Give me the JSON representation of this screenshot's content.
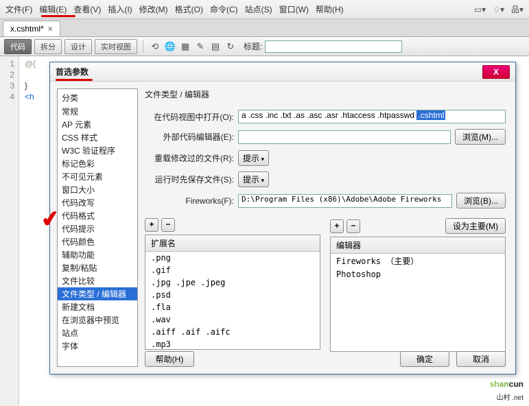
{
  "menu": {
    "items": [
      "文件(F)",
      "编辑(E)",
      "查看(V)",
      "插入(I)",
      "修改(M)",
      "格式(O)",
      "命令(C)",
      "站点(S)",
      "窗口(W)",
      "帮助(H)"
    ]
  },
  "tab": {
    "name": "x.cshtml*"
  },
  "toolbar": {
    "buttons": [
      "代码",
      "拆分",
      "设计",
      "实时视图"
    ],
    "title_label": "标题:"
  },
  "gutter": [
    "1",
    "2",
    "3",
    "4"
  ],
  "code": {
    "l1": "@{",
    "l2": "",
    "l3": "}",
    "l4": "<h"
  },
  "dialog": {
    "title": "首选参数",
    "category_header": "分类",
    "categories": [
      "常规",
      "AP 元素",
      "CSS 样式",
      "W3C 验证程序",
      "标记色彩",
      "不可见元素",
      "窗口大小",
      "代码改写",
      "代码格式",
      "代码提示",
      "代码颜色",
      "辅助功能",
      "复制/粘贴",
      "文件比较",
      "文件类型 / 编辑器",
      "新建文档",
      "在浏览器中预览",
      "站点",
      "字体"
    ],
    "selected_category_index": 14,
    "main_title": "文件类型 / 编辑器",
    "rows": {
      "open_in_code": {
        "label": "在代码视图中打开(O):",
        "value_prefix": "a .css .inc .txt .as .asc .asr .htaccess .htpasswd ",
        "value_sel": ".cshtml"
      },
      "external_editor": {
        "label": "外部代码编辑器(E):",
        "value": "",
        "browse": "浏览(M)..."
      },
      "reload": {
        "label": "重载修改过的文件(R):",
        "button": "提示"
      },
      "save_on_run": {
        "label": "运行时先保存文件(S):",
        "button": "提示"
      },
      "fireworks": {
        "label": "Fireworks(F):",
        "value": "D:\\Program Files (x86)\\Adobe\\Adobe Fireworks",
        "browse": "浏览(B)..."
      }
    },
    "left_list": {
      "set_primary": "设为主要(M)",
      "header": "扩展名",
      "items": [
        ".png",
        ".gif",
        ".jpg .jpe .jpeg",
        ".psd",
        ".fla",
        ".wav",
        ".aiff .aif .aifc",
        ".mp3"
      ]
    },
    "right_list": {
      "header": "编辑器",
      "items": [
        "Fireworks （主要）",
        "Photoshop"
      ]
    },
    "footer": {
      "help": "帮助(H)",
      "ok": "确定",
      "cancel": "取消"
    }
  },
  "watermark": {
    "brand": "shancun",
    "domain": "山村 .net"
  }
}
